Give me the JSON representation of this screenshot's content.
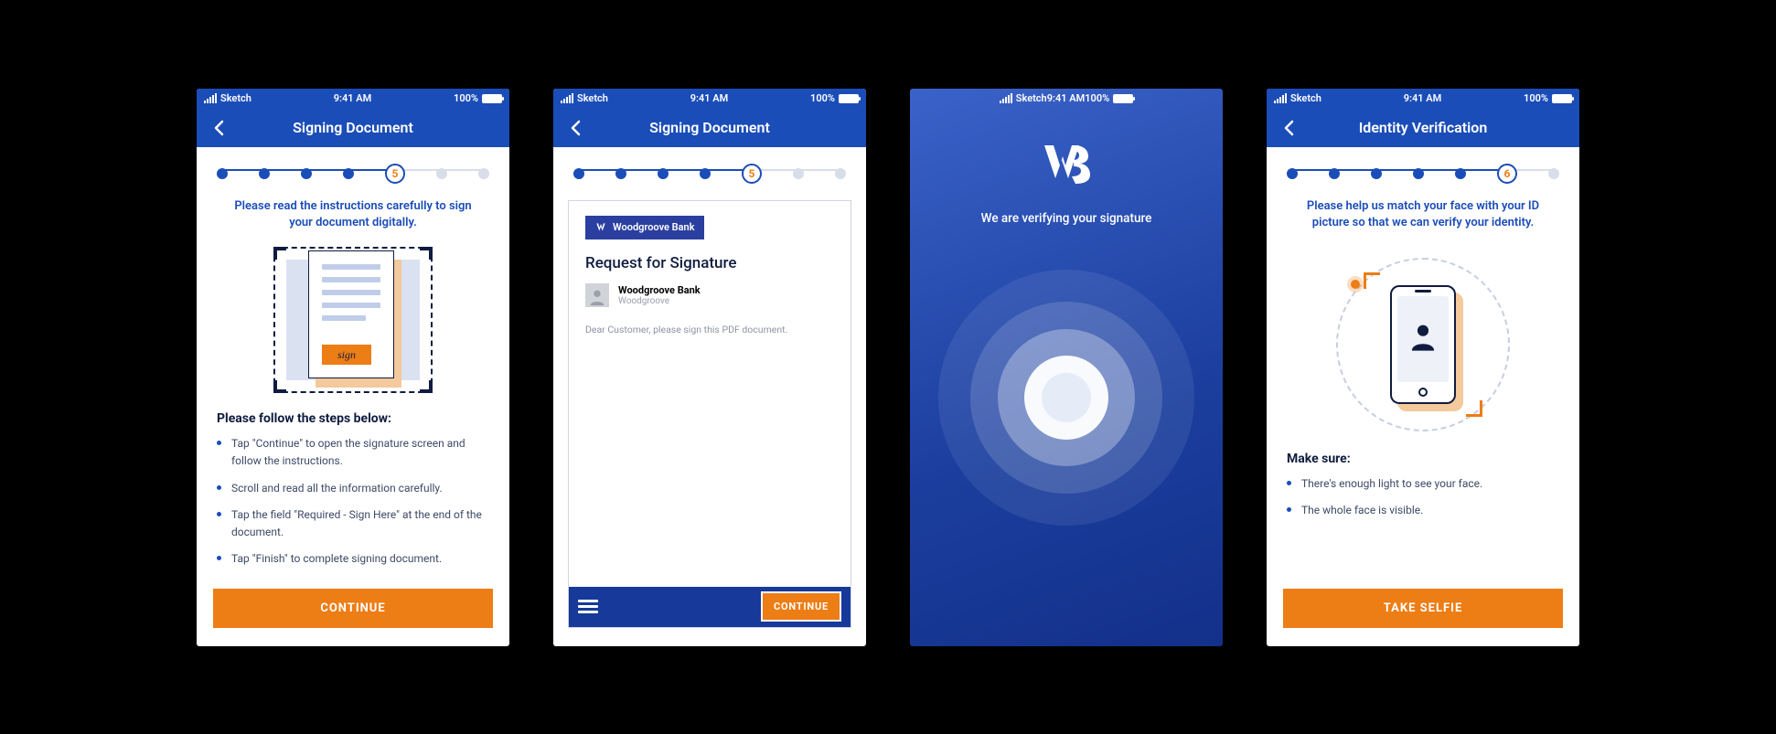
{
  "status": {
    "carrier": "Sketch",
    "time": "9:41 AM",
    "battery": "100%"
  },
  "colors": {
    "primary": "#1b4db8",
    "accent": "#ed7d15",
    "dark": "#0f1c3f"
  },
  "screen1": {
    "title": "Signing Document",
    "step": "5",
    "instruction": "Please read the instructions carefully to sign your document digitally.",
    "sign_tag": "sign",
    "steps_title": "Please follow the steps below:",
    "steps": [
      "Tap \"Continue\" to open the signature screen and follow the instructions.",
      "Scroll and read all the information carefully.",
      "Tap the field \"Required - Sign Here\" at the end of the document.",
      "Tap \"Finish\" to complete signing document."
    ],
    "cta": "CONTINUE"
  },
  "screen2": {
    "title": "Signing Document",
    "step": "5",
    "bank_name": "Woodgroove Bank",
    "request_title": "Request for Signature",
    "requester_name": "Woodgroove Bank",
    "requester_sub": "Woodgroove",
    "message": "Dear Customer, please sign this PDF document.",
    "cta": "CONTINUE"
  },
  "screen3": {
    "message": "We are verifying your signature"
  },
  "screen4": {
    "title": "Identity Verification",
    "step": "6",
    "instruction": "Please help us match your face with your ID picture so that we can verify your identity.",
    "steps_title": "Make sure:",
    "steps": [
      "There's enough light to see your face.",
      "The whole face is visible."
    ],
    "cta": "TAKE SELFIE"
  }
}
